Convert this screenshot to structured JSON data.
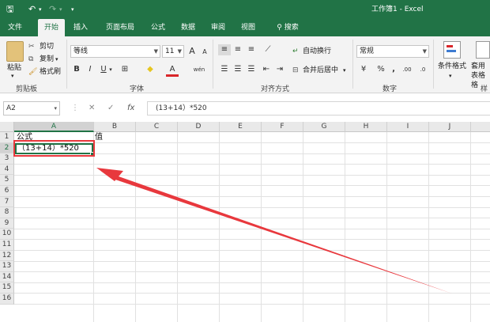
{
  "titlebar": {
    "save_icon": "🖫",
    "undo_icon": "↶",
    "undo_caret": "▾",
    "redo_icon": "↷",
    "redo_caret": "▾",
    "customize_icon": "▾",
    "title": "工作簿1  -  Excel"
  },
  "tabs": [
    "文件",
    "开始",
    "插入",
    "页面布局",
    "公式",
    "数据",
    "审阅",
    "视图"
  ],
  "tell_me": {
    "icon": "⚲",
    "label": "搜索"
  },
  "ribbon": {
    "clipboard": {
      "paste": "粘贴",
      "paste_caret": "▾",
      "cut": "剪切",
      "copy": "复制",
      "copy_caret": "▾",
      "format_painter": "格式刷",
      "group_label": "剪贴板"
    },
    "font": {
      "name": "等线",
      "size": "11",
      "grow": "A",
      "shrink": "A",
      "bold": "B",
      "italic": "I",
      "underline": "U",
      "underline_caret": "▾",
      "border_icon": "⊞",
      "fill_icon": "◆",
      "font_color_icon": "A",
      "phonetic_icon": "wén",
      "group_label": "字体"
    },
    "alignment": {
      "wrap_text": "自动换行",
      "merge_center": "合并后居中",
      "merge_caret": "▾",
      "group_label": "对齐方式"
    },
    "number": {
      "format": "常规",
      "currency": "¥",
      "percent": "%",
      "comma": ",",
      "increase_decimal": ".00",
      "decrease_decimal": ".0",
      "group_label": "数字"
    },
    "styles": {
      "conditional_format": "条件格式",
      "conditional_caret": "▾",
      "table_format": "套用表格格",
      "styles_partial": "样"
    }
  },
  "formula_bar": {
    "name_box": "A2",
    "name_caret": "▾",
    "more": "⋮",
    "cancel": "✕",
    "enter": "✓",
    "fx": "fx",
    "formula": "(13+14）*520"
  },
  "sheet": {
    "columns": [
      "A",
      "B",
      "C",
      "D",
      "E",
      "F",
      "G",
      "H",
      "I",
      "J"
    ],
    "rows": [
      "1",
      "2",
      "3",
      "4",
      "5",
      "6",
      "7",
      "8",
      "9",
      "10",
      "11",
      "12",
      "13",
      "14",
      "15",
      "16"
    ],
    "cells": {
      "A1": "公式",
      "B1": "值",
      "A2": "（13+14）*520"
    }
  },
  "colors": {
    "brand": "#217346",
    "annotation": "#e8383d"
  }
}
